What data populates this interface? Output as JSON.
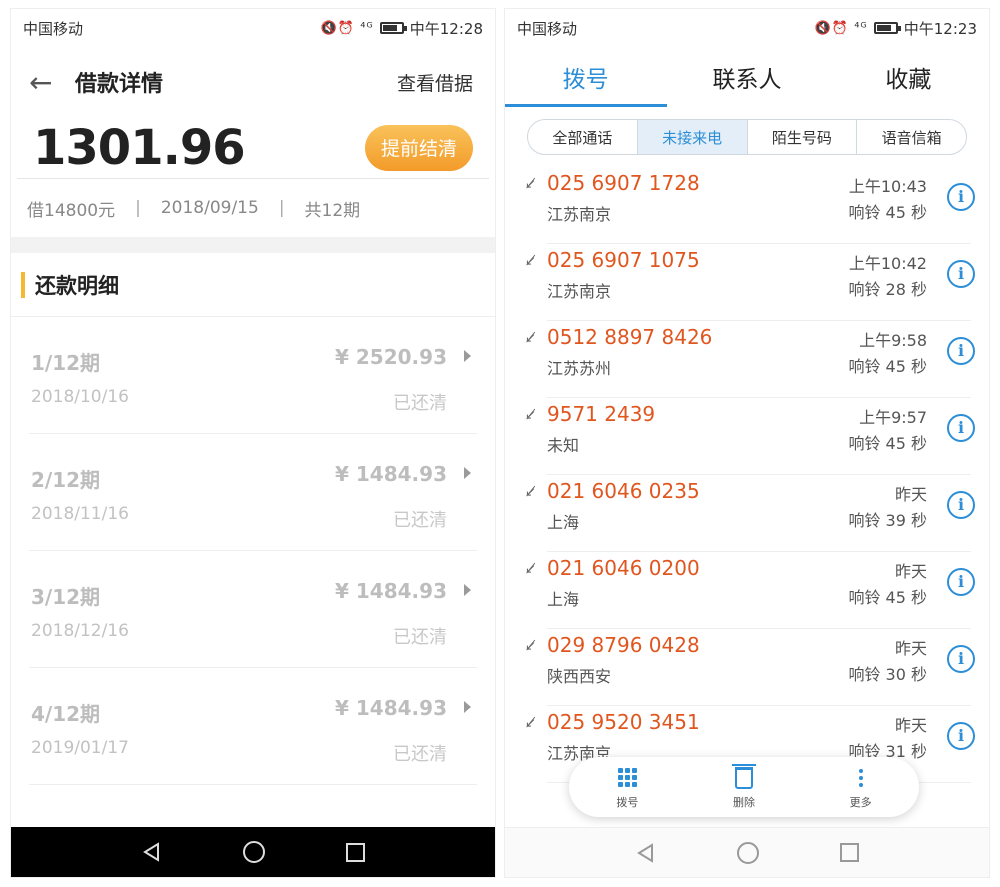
{
  "left": {
    "status": {
      "carrier": "中国移动",
      "icons": "🔇⏰ ⁴ᴳ",
      "time": "中午12:28"
    },
    "header": {
      "back": "←",
      "title": "借款详情",
      "link": "查看借据"
    },
    "amount": "1301.96",
    "payoff_button": "提前结清",
    "meta": {
      "principal": "借14800元",
      "date": "2018/09/15",
      "periods": "共12期"
    },
    "section_title": "还款明细",
    "installments": [
      {
        "period": "1/12期",
        "date": "2018/10/16",
        "amount": "¥ 2520.93",
        "state": "已还清"
      },
      {
        "period": "2/12期",
        "date": "2018/11/16",
        "amount": "¥ 1484.93",
        "state": "已还清"
      },
      {
        "period": "3/12期",
        "date": "2018/12/16",
        "amount": "¥ 1484.93",
        "state": "已还清"
      },
      {
        "period": "4/12期",
        "date": "2019/01/17",
        "amount": "¥ 1484.93",
        "state": "已还清"
      }
    ]
  },
  "right": {
    "status": {
      "carrier": "中国移动",
      "icons": "🔇⏰ ⁴ᴳ",
      "time": "中午12:23"
    },
    "tabs": [
      "拨号",
      "联系人",
      "收藏"
    ],
    "filters": [
      "全部通话",
      "未接来电",
      "陌生号码",
      "语音信箱"
    ],
    "calls": [
      {
        "number": "025 6907 1728",
        "location": "江苏南京",
        "time": "上午10:43",
        "ring": "响铃 45 秒"
      },
      {
        "number": "025 6907 1075",
        "location": "江苏南京",
        "time": "上午10:42",
        "ring": "响铃 28 秒"
      },
      {
        "number": "0512 8897 8426",
        "location": "江苏苏州",
        "time": "上午9:58",
        "ring": "响铃 45 秒"
      },
      {
        "number": "9571 2439",
        "location": "未知",
        "time": "上午9:57",
        "ring": "响铃 45 秒"
      },
      {
        "number": "021 6046 0235",
        "location": "上海",
        "time": "昨天",
        "ring": "响铃 39 秒"
      },
      {
        "number": "021 6046 0200",
        "location": "上海",
        "time": "昨天",
        "ring": "响铃 45 秒"
      },
      {
        "number": "029 8796 0428",
        "location": "陕西西安",
        "time": "昨天",
        "ring": "响铃 30 秒"
      },
      {
        "number": "025 9520 3451",
        "location": "江苏南京",
        "time": "昨天",
        "ring": "响铃 31 秒"
      }
    ],
    "toolbar": {
      "dial": "拨号",
      "delete": "删除",
      "more": "更多"
    },
    "missed_icon": "missed-call-icon",
    "info_icon_char": "i"
  },
  "colors": {
    "accent_blue": "#2c8ed6",
    "missed_red": "#e0561f",
    "payoff_orange": "#f39b2a",
    "section_bar": "#f6b833"
  }
}
